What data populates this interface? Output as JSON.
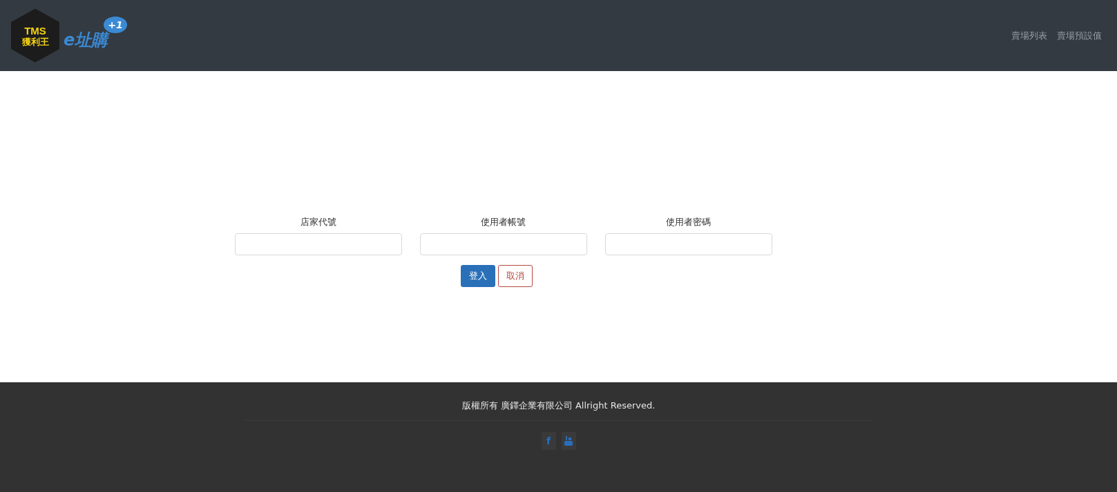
{
  "header": {
    "logo": {
      "badge_top": "TMS",
      "badge_bottom": "獲利王",
      "brand": "e址購",
      "bubble": "+1"
    },
    "nav": [
      {
        "label": "賣場列表"
      },
      {
        "label": "賣場預設值"
      }
    ]
  },
  "login_form": {
    "fields": [
      {
        "label": "店家代號"
      },
      {
        "label": "使用者帳號"
      },
      {
        "label": "使用者密碼"
      }
    ],
    "buttons": [
      {
        "label": "登入",
        "kind": "primary"
      },
      {
        "label": "取消",
        "kind": "cancel"
      }
    ]
  },
  "footer": {
    "copyright": "版權所有 廣鐸企業有限公司 Allright Reserved.",
    "social": [
      {
        "kind": "facebook",
        "glyph": "f"
      },
      {
        "kind": "youtube"
      }
    ]
  }
}
